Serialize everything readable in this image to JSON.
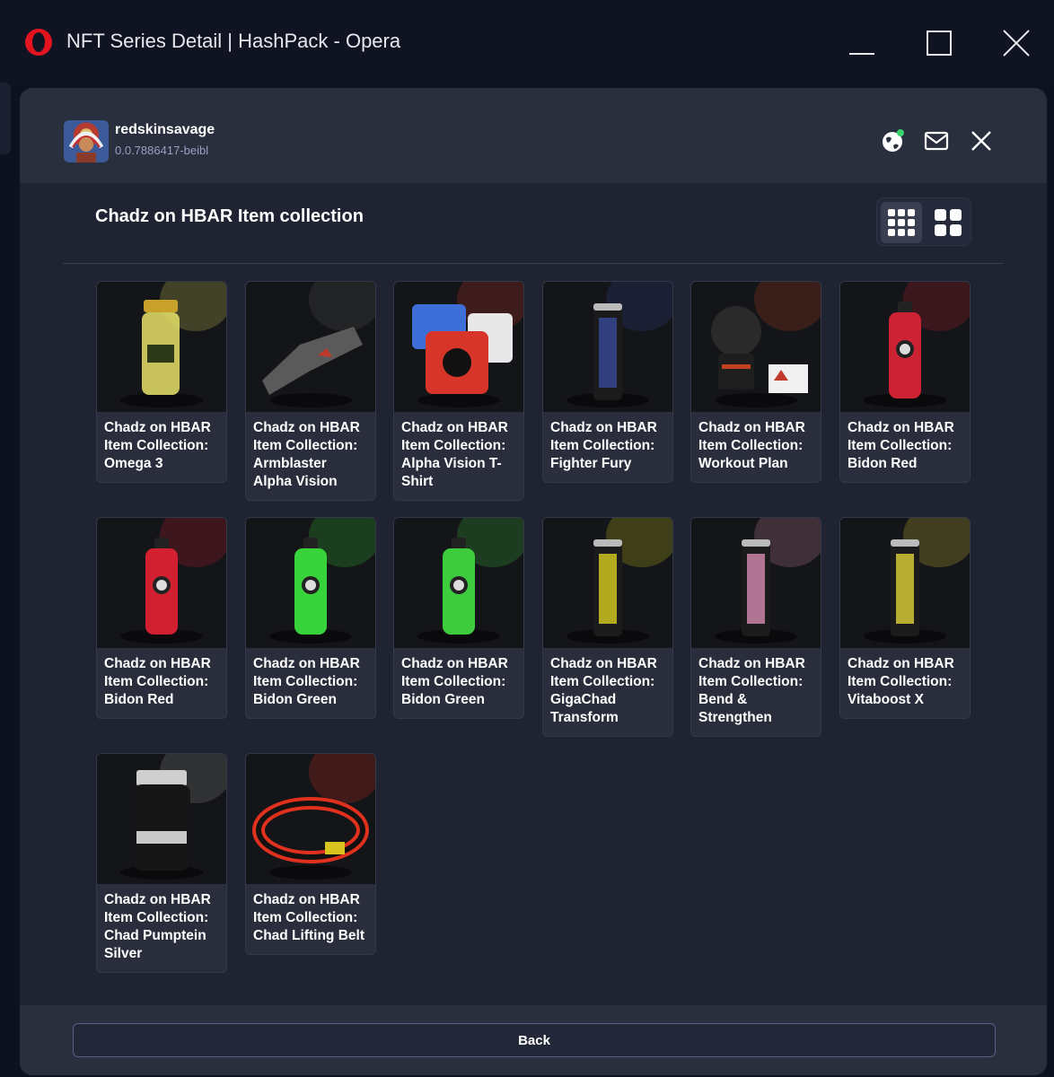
{
  "window": {
    "title": "NFT Series Detail | HashPack - Opera"
  },
  "account": {
    "name": "redskinsavage",
    "id": "0.0.7886417-beibl"
  },
  "header_icons": [
    "globe-status-icon",
    "mail-icon",
    "close-icon"
  ],
  "collection": {
    "title": "Chadz on HBAR Item collection",
    "view_options": [
      "grid-small-view",
      "grid-large-view"
    ],
    "selected_view": "grid-small-view"
  },
  "items": [
    {
      "label": "Chadz on HBAR Item Collection: Omega 3",
      "icon": "supplement-jar",
      "accent": "#e8e26a"
    },
    {
      "label": "Chadz on HBAR Item Collection: Armblaster Alpha Vision",
      "icon": "armblaster",
      "accent": "#5a5a5a"
    },
    {
      "label": "Chadz on HBAR Item Collection: Alpha Vision T-Shirt",
      "icon": "t-shirts",
      "accent": "#d8352a"
    },
    {
      "label": "Chadz on HBAR Item Collection: Fighter Fury",
      "icon": "energy-can",
      "accent": "#3a4a9a"
    },
    {
      "label": "Chadz on HBAR Item Collection: Workout Plan",
      "icon": "workout-plan",
      "accent": "#c2401f"
    },
    {
      "label": "Chadz on HBAR Item Collection: Bidon Red",
      "icon": "bottle",
      "accent": "#cc2233"
    },
    {
      "label": "Chadz on HBAR Item Collection: Bidon Red",
      "icon": "bottle",
      "accent": "#d22030"
    },
    {
      "label": "Chadz on HBAR Item Collection: Bidon Green",
      "icon": "bottle",
      "accent": "#38d23a"
    },
    {
      "label": "Chadz on HBAR Item Collection: Bidon Green",
      "icon": "bottle",
      "accent": "#3ccc3e"
    },
    {
      "label": "Chadz on HBAR Item Collection: GigaChad Transform",
      "icon": "energy-can",
      "accent": "#d8d020"
    },
    {
      "label": "Chadz on HBAR Item Collection: Bend & Strengthen",
      "icon": "energy-can",
      "accent": "#d78bb0"
    },
    {
      "label": "Chadz on HBAR Item Collection: Vitaboost X",
      "icon": "energy-can",
      "accent": "#e0d23a"
    },
    {
      "label": "Chadz on HBAR Item Collection: Chad Pumptein Silver",
      "icon": "protein-tub",
      "accent": "#9a9a9a"
    },
    {
      "label": "Chadz on HBAR Item Collection: Chad Lifting Belt",
      "icon": "lifting-belt",
      "accent": "#e0301e"
    }
  ],
  "footer": {
    "back_label": "Back"
  },
  "colors": {
    "background": "#0e1220",
    "modal": "#2a2f3e",
    "content": "#1f2332",
    "card": "#2a2e3c",
    "account_id": "#9aa0c4"
  }
}
